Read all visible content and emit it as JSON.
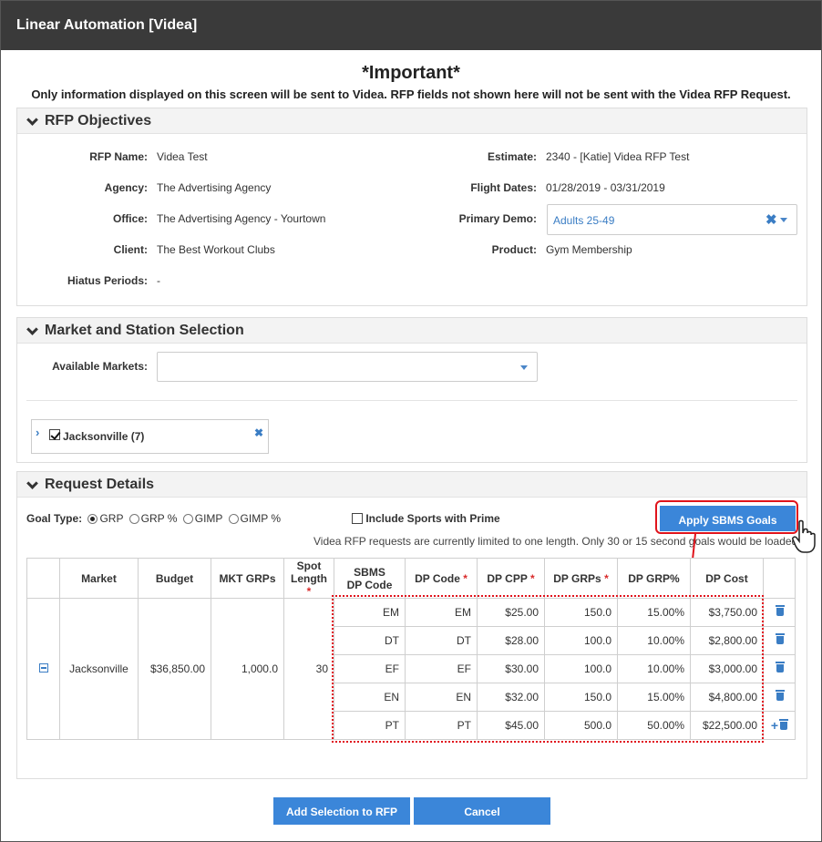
{
  "window": {
    "title": "Linear Automation [Videa]"
  },
  "header": {
    "important": "*Important*",
    "notice": "Only information displayed on this screen will be sent to Videa. RFP fields not shown here will not be sent with the Videa RFP Request."
  },
  "objectives": {
    "title": "RFP Objectives",
    "rfp_name_label": "RFP Name:",
    "rfp_name": "Videa Test",
    "agency_label": "Agency:",
    "agency": "The Advertising Agency",
    "office_label": "Office:",
    "office": "The Advertising Agency - Yourtown",
    "client_label": "Client:",
    "client": "The Best Workout Clubs",
    "hiatus_label": "Hiatus Periods:",
    "hiatus": "-",
    "estimate_label": "Estimate:",
    "estimate": "2340 - [Katie] Videa RFP Test",
    "flight_label": "Flight Dates:",
    "flight": "01/28/2019 - 03/31/2019",
    "demo_label": "Primary Demo:",
    "demo": "Adults 25-49",
    "product_label": "Product:",
    "product": "Gym Membership"
  },
  "market": {
    "title": "Market and Station Selection",
    "available_label": "Available Markets:",
    "available_value": "",
    "selected_market": "Jacksonville (7)",
    "selected_checked": true
  },
  "request": {
    "title": "Request Details",
    "goal_type_label": "Goal Type:",
    "goal_options": [
      "GRP",
      "GRP %",
      "GIMP",
      "GIMP %"
    ],
    "goal_selected": "GRP",
    "include_sports_label": "Include Sports with Prime",
    "include_sports_checked": false,
    "apply_button": "Apply SBMS Goals",
    "length_notice": "Videa RFP requests are currently limited to one length. Only 30 or 15 second goals would be loaded.",
    "columns": {
      "market": "Market",
      "budget": "Budget",
      "mkt_grps": "MKT GRPs",
      "spot_length_1": "Spot",
      "spot_length_2": "Length",
      "sbms_1": "SBMS",
      "sbms_2": "DP Code",
      "dp_code": "DP Code",
      "dp_cpp": "DP CPP",
      "dp_grps": "DP GRPs",
      "dp_grp_pct": "DP GRP%",
      "dp_cost": "DP Cost"
    },
    "group": {
      "market": "Jacksonville",
      "budget": "$36,850.00",
      "mkt_grps": "1,000.0",
      "spot_length": "30"
    },
    "rows": [
      {
        "sbms": "EM",
        "code": "EM",
        "cpp": "$25.00",
        "grps": "150.0",
        "pct": "15.00%",
        "cost": "$3,750.00"
      },
      {
        "sbms": "DT",
        "code": "DT",
        "cpp": "$28.00",
        "grps": "100.0",
        "pct": "10.00%",
        "cost": "$2,800.00"
      },
      {
        "sbms": "EF",
        "code": "EF",
        "cpp": "$30.00",
        "grps": "100.0",
        "pct": "10.00%",
        "cost": "$3,000.00"
      },
      {
        "sbms": "EN",
        "code": "EN",
        "cpp": "$32.00",
        "grps": "150.0",
        "pct": "15.00%",
        "cost": "$4,800.00"
      },
      {
        "sbms": "PT",
        "code": "PT",
        "cpp": "$45.00",
        "grps": "500.0",
        "pct": "50.00%",
        "cost": "$22,500.00"
      }
    ]
  },
  "footer": {
    "add_button": "Add Selection to RFP",
    "cancel_button": "Cancel"
  },
  "colors": {
    "primary": "#3b86d9",
    "highlight": "#e0141c",
    "titlebar": "#3a3a3a"
  }
}
